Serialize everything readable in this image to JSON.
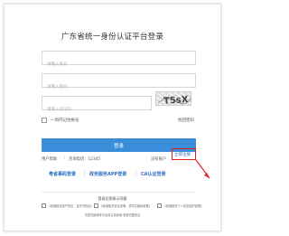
{
  "page": {
    "title": "广东省统一身份认证平台登录"
  },
  "form": {
    "account_placeholder": "请输入账号",
    "password_placeholder": "请输入密码",
    "captcha_placeholder": "请输入验证码",
    "captcha_text": "T5sX",
    "remember_label": "一周内记住帐号",
    "forgot_label": "找回密码",
    "login_label": "登录"
  },
  "help": {
    "user_help": "用户帮助",
    "separator": "|",
    "phone": "咨询电话：12345",
    "no_account": "没有账户",
    "register": "立即注册"
  },
  "links": [
    {
      "label": "粤省事码登录"
    },
    {
      "label": "政务服务APP登录"
    },
    {
      "label": "CA认证登录"
    }
  ],
  "agreement": {
    "title": "登录后即表示同意",
    "items": [
      "《阅读相关用户协议，且许可协议》",
      "《阅读相关协议说明，并同意隐私政策》",
      "《阅读相关个人信息保护说明》"
    ],
    "note": "请您在使用本平台前认真阅读 查看完整协议"
  },
  "colors": {
    "accent": "#3a8ed9",
    "link": "#2a6fc1",
    "highlight": "#e02020"
  }
}
